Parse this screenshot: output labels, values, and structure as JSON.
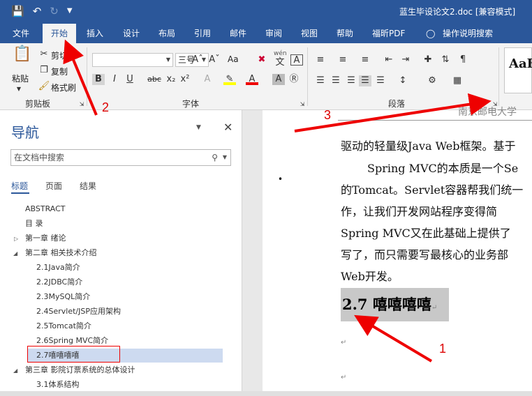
{
  "window": {
    "title": "蓝生毕设论文2.doc [兼容模式]"
  },
  "qat": {
    "save_icon": "save-icon",
    "undo_icon": "undo-icon",
    "redo_icon": "redo-icon",
    "customize_icon": "customize-qat-icon"
  },
  "tabs": [
    "文件",
    "开始",
    "插入",
    "设计",
    "布局",
    "引用",
    "邮件",
    "审阅",
    "视图",
    "帮助",
    "福昕PDF",
    "操作说明搜索"
  ],
  "clipboard": {
    "paste": "粘贴",
    "cut": "剪切",
    "copy": "复制",
    "format_painter": "格式刷",
    "label": "剪贴板"
  },
  "font": {
    "name": "",
    "size": "三号",
    "label": "字体",
    "wen": "wén",
    "aa": "Aa",
    "bold": "B",
    "italic": "I",
    "underline": "U",
    "strike": "abc",
    "sub": "x₂",
    "sup": "x²"
  },
  "paragraph": {
    "label": "段落"
  },
  "styles": {
    "preview": "AaB"
  },
  "nav": {
    "title": "导航",
    "search_placeholder": "在文档中搜索",
    "tabs": [
      "标题",
      "页面",
      "结果"
    ],
    "items": [
      "ABSTRACT",
      "目  录",
      "第一章  绪论",
      "第二章  相关技术介绍",
      "2.1Java简介",
      "2.2JDBC简介",
      "2.3MySQL简介",
      "2.4Servlet/JSP应用架构",
      "2.5Tomcat简介",
      "2.6Spring MVC简介",
      "2.7嘻嘻嘻嘻",
      "第三章  影院订票系统的总体设计",
      "3.1体系结构"
    ]
  },
  "document": {
    "header": "南京邮电大学",
    "lines": [
      "驱动的轻量级Java Web框架。基于",
      "Spring MVC的本质是一个Se",
      "的Tomcat。Servlet容器帮我们统一",
      "作，让我们开发网站程序变得简",
      "Spring  MVC又在此基础上提供了",
      "写了，而只需要写最核心的业务部",
      "Web开发。"
    ],
    "heading": "2.7 嘻嘻嘻嘻"
  },
  "annotations": [
    "1",
    "2",
    "3"
  ]
}
